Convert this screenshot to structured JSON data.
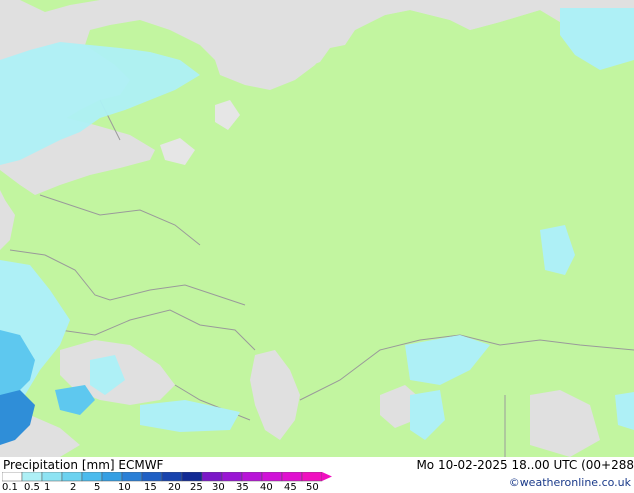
{
  "map": {
    "colors": {
      "land": "#c2f5a0",
      "sea": "#e0e0e0",
      "water_inland": "#e6e6e6",
      "border": "#9a9a9a",
      "precip_light": "#aef0f6",
      "precip_mid": "#5ec8ef",
      "precip_heavy": "#2f8ed8"
    }
  },
  "footer": {
    "title_left": "Precipitation [mm]  ECMWF",
    "title_right": "Mo 10-02-2025 18..00 UTC (00+288",
    "credit": "©weatheronline.co.uk",
    "scale_colors": [
      "#ffffff",
      "#aef0f6",
      "#8ee3f3",
      "#6cd2f0",
      "#4cbbed",
      "#359fe3",
      "#2a7fd6",
      "#1f5fc4",
      "#1843ad",
      "#122a94",
      "#7b18c8",
      "#9a16d4",
      "#b814d8",
      "#d012d8",
      "#e010d0",
      "#f010c0"
    ],
    "scale_labels": [
      "0.1",
      "0.5",
      "1",
      "2",
      "5",
      "10",
      "15",
      "20",
      "25",
      "30",
      "35",
      "40",
      "45",
      "50"
    ]
  }
}
